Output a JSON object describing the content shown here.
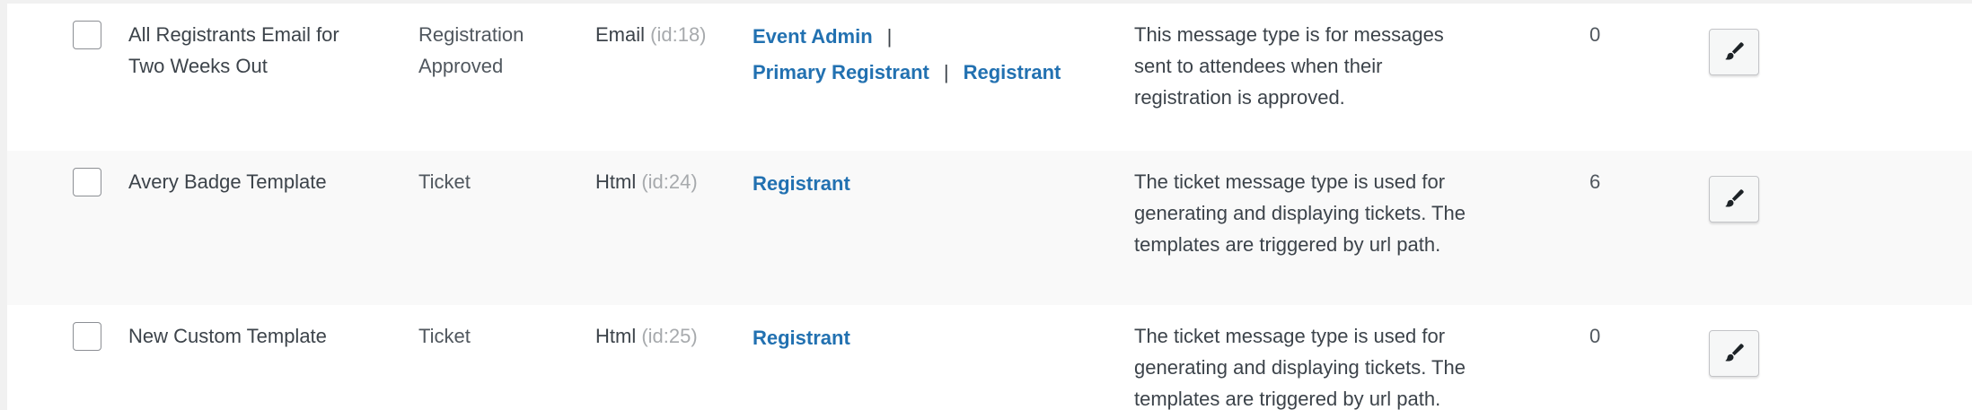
{
  "rows": [
    {
      "name": "All Registrants Email for Two Weeks Out",
      "message_type": "Registration Approved",
      "messenger": "Email",
      "messenger_id": "(id:18)",
      "contexts": [
        "Event Admin",
        "Primary Registrant",
        "Registrant"
      ],
      "description": "This message type is for messages sent to attendees when their registration is approved.",
      "count": "0"
    },
    {
      "name": "Avery Badge Template",
      "message_type": "Ticket",
      "messenger": "Html",
      "messenger_id": "(id:24)",
      "contexts": [
        "Registrant"
      ],
      "description": "The ticket message type is used for generating and displaying tickets. The templates are triggered by url path.",
      "count": "6"
    },
    {
      "name": "New Custom Template",
      "message_type": "Ticket",
      "messenger": "Html",
      "messenger_id": "(id:25)",
      "contexts": [
        "Registrant"
      ],
      "description": "The ticket message type is used for generating and displaying tickets. The templates are triggered by url path.",
      "count": "0"
    }
  ],
  "separator": "|",
  "icons": {
    "edit": "paintbrush-icon"
  },
  "colors": {
    "link": "#2271b1",
    "text": "#3c434a",
    "muted_id": "#a7aaad"
  }
}
